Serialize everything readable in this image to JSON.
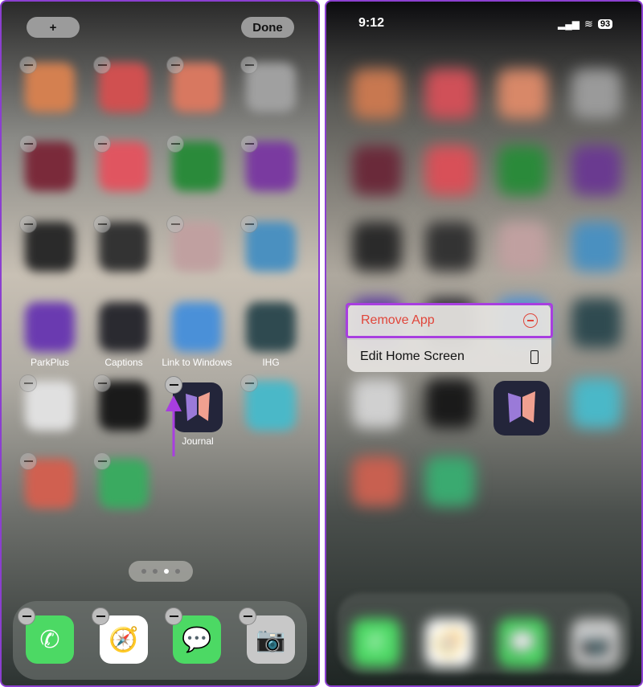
{
  "left": {
    "add_label": "+",
    "done_label": "Done",
    "labels": [
      "ParkPlus",
      "Captions",
      "Link to Windows",
      "IHG",
      "Journal"
    ],
    "grid_colors": [
      [
        "#d48050",
        "#d05050",
        "#d87860",
        "#a0a0a0"
      ],
      [
        "#7a2a3a",
        "#e05560",
        "#2a8a3a",
        "#7a3aa0"
      ],
      [
        "#2a2a2a",
        "#333333",
        "#c0a0a0",
        "#4a90c0"
      ],
      [
        "#6a3ab0",
        "#2a2a30",
        "#4a90d8",
        "#2f4a50"
      ],
      [
        "#e0e0e0",
        "#1a1a1a",
        null,
        "#4ab8c8"
      ],
      [
        "#d06050",
        "#3aaa60",
        null,
        null
      ]
    ],
    "page_dots": 4,
    "active_page": 2,
    "dock": [
      {
        "icon": "phone-icon",
        "color": "#4cd964"
      },
      {
        "icon": "safari-icon",
        "color": "#ffffff"
      },
      {
        "icon": "messages-icon",
        "color": "#4cd964"
      },
      {
        "icon": "camera-icon",
        "color": "#c8c8c8"
      }
    ]
  },
  "right": {
    "time": "9:12",
    "battery": "93",
    "menu": {
      "remove_label": "Remove App",
      "edit_label": "Edit Home Screen",
      "highlight_color": "#a83ee0",
      "remove_color": "#e0453a"
    },
    "grid_colors": [
      [
        "#c87850",
        "#d05058",
        "#d88868",
        "#9a9a9a"
      ],
      [
        "#6a2a3a",
        "#d85058",
        "#2a8a3a",
        "#6a3a90"
      ],
      [
        "#2a2a2a",
        "#333333",
        "#c0a0a0",
        "#4a90c0"
      ],
      [
        "#5a3aa0",
        "#2a2a30",
        "#4a90d8",
        "#2f4a50"
      ],
      [
        "#d0d0d0",
        "#1a1a1a",
        null,
        "#4ab8c8"
      ],
      [
        "#c86050",
        "#3aaa70",
        null,
        null
      ]
    ]
  }
}
